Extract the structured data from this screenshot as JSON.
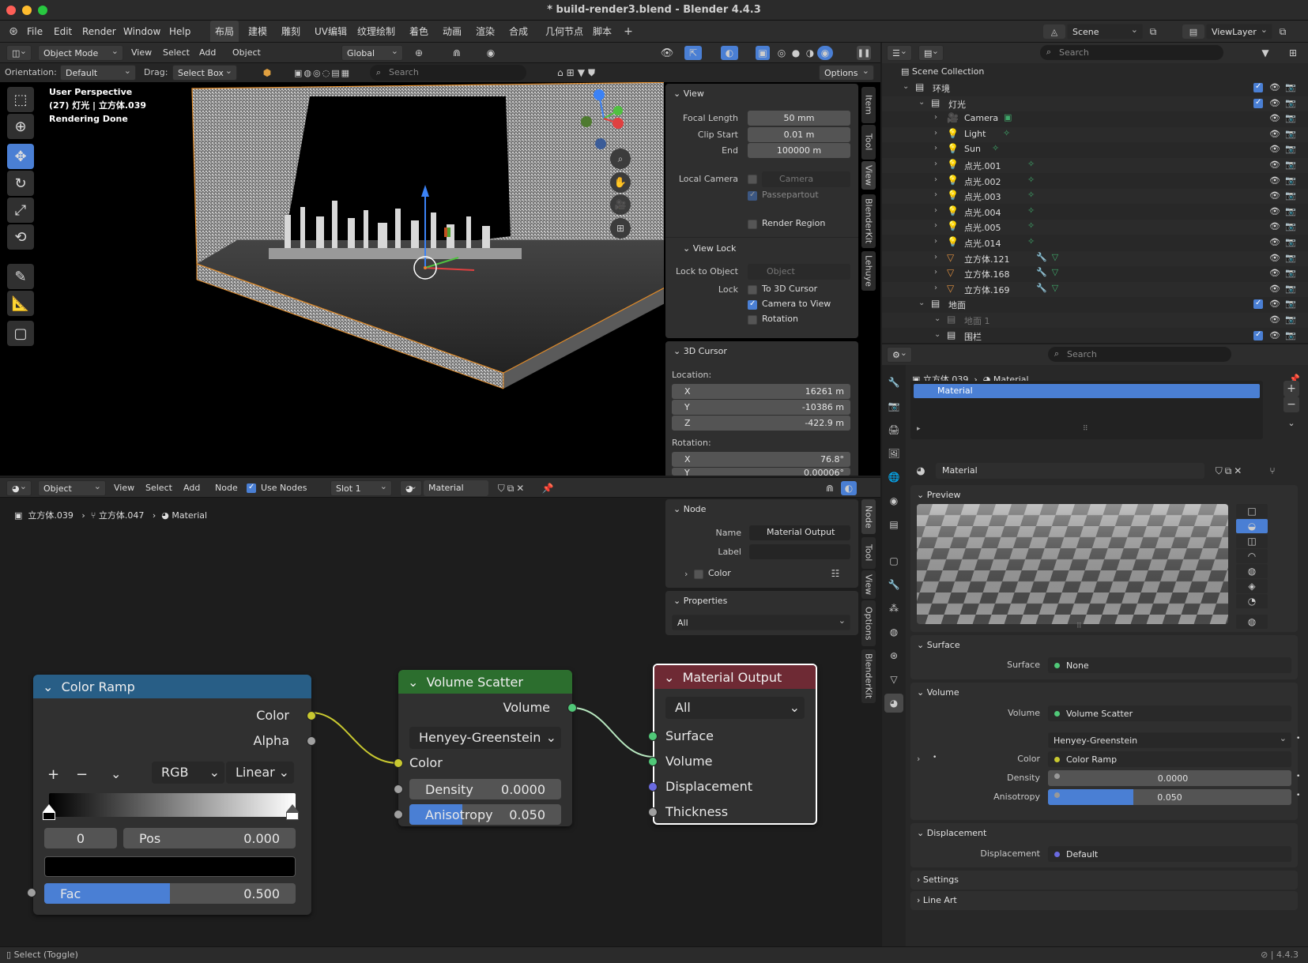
{
  "title": "* build-render3.blend - Blender 4.4.3",
  "menu": [
    "File",
    "Edit",
    "Render",
    "Window",
    "Help"
  ],
  "workspaces": [
    "布局",
    "建模",
    "雕刻",
    "UV编辑",
    "纹理绘制",
    "着色",
    "动画",
    "渲染",
    "合成",
    "几何节点",
    "脚本"
  ],
  "scene": "Scene",
  "viewlayer": "ViewLayer",
  "vp_header": {
    "mode": "Object Mode",
    "items": [
      "View",
      "Select",
      "Add",
      "Object"
    ],
    "transform": "Global"
  },
  "vp_tool": {
    "orientation_label": "Orientation:",
    "orientation": "Default",
    "drag_label": "Drag:",
    "drag": "Select Box",
    "search": "Search",
    "options": "Options"
  },
  "overlay": {
    "line1": "User Perspective",
    "line2": "(27) 灯光 | 立方体.039",
    "line3": "Rendering Done"
  },
  "sidebar_tabs": [
    "Item",
    "Tool",
    "View",
    "BlenderKit",
    "Lehuye"
  ],
  "view_panel": {
    "title": "View",
    "focal_label": "Focal Length",
    "focal": "50 mm",
    "clip_start_label": "Clip Start",
    "clip_start": "0.01 m",
    "end_label": "End",
    "end": "100000 m",
    "local_cam_label": "Local Camera",
    "camera_ph": "Camera",
    "passepartout": "Passepartout",
    "render_region": "Render Region"
  },
  "view_lock": {
    "title": "View Lock",
    "lock_obj_label": "Lock to Object",
    "object_ph": "Object",
    "lock_label": "Lock",
    "to_cursor": "To 3D Cursor",
    "camera_to_view": "Camera to View",
    "rotation": "Rotation"
  },
  "cursor": {
    "title": "3D Cursor",
    "location": "Location:",
    "x": "16261 m",
    "y": "-10386 m",
    "z": "-422.9 m",
    "rotation": "Rotation:",
    "rx": "76.8°",
    "ry": "0.00006°",
    "xl": "X",
    "yl": "Y",
    "zl": "Z"
  },
  "outliner": {
    "search": "Search",
    "root": "Scene Collection",
    "rows": [
      {
        "n": "环境",
        "d": 0,
        "t": "col",
        "cb": true
      },
      {
        "n": "灯光",
        "d": 1,
        "t": "col",
        "cb": true
      },
      {
        "n": "Camera",
        "d": 2,
        "t": "cam"
      },
      {
        "n": "Light",
        "d": 2,
        "t": "light"
      },
      {
        "n": "Sun",
        "d": 2,
        "t": "light"
      },
      {
        "n": "点光.001",
        "d": 2,
        "t": "light"
      },
      {
        "n": "点光.002",
        "d": 2,
        "t": "light"
      },
      {
        "n": "点光.003",
        "d": 2,
        "t": "light"
      },
      {
        "n": "点光.004",
        "d": 2,
        "t": "light"
      },
      {
        "n": "点光.005",
        "d": 2,
        "t": "light"
      },
      {
        "n": "点光.014",
        "d": 2,
        "t": "light"
      },
      {
        "n": "立方体.121",
        "d": 2,
        "t": "mesh"
      },
      {
        "n": "立方体.168",
        "d": 2,
        "t": "mesh"
      },
      {
        "n": "立方体.169",
        "d": 2,
        "t": "mesh"
      },
      {
        "n": "地面",
        "d": 1,
        "t": "col",
        "cb": true
      },
      {
        "n": "地面 1",
        "d": 2,
        "t": "coldis"
      },
      {
        "n": "围栏",
        "d": 2,
        "t": "col",
        "cb": true
      }
    ]
  },
  "props": {
    "search": "Search",
    "crumb1": "立方体.039",
    "crumb2": "Material",
    "slot": "Material",
    "mat_name": "Material",
    "preview": "Preview",
    "surface_sec": "Surface",
    "surface_label": "Surface",
    "surface_val": "None",
    "volume_sec": "Volume",
    "volume_label": "Volume",
    "volume_val": "Volume Scatter",
    "phase": "Henyey-Greenstein",
    "color_label": "Color",
    "color_val": "Color Ramp",
    "density_label": "Density",
    "density": "0.0000",
    "aniso_label": "Anisotropy",
    "aniso": "0.050",
    "aniso_fill": 0.05,
    "disp_sec": "Displacement",
    "disp_label": "Displacement",
    "disp_val": "Default",
    "settings": "Settings",
    "lineart": "Line Art"
  },
  "node_header": {
    "type": "Object",
    "items": [
      "View",
      "Select",
      "Add",
      "Node"
    ],
    "use_nodes": "Use Nodes",
    "slot": "Slot 1",
    "material": "Material"
  },
  "node_crumb": [
    "立方体.039",
    "立方体.047",
    "Material"
  ],
  "node_sidebar": {
    "node_sec": "Node",
    "name_label": "Name",
    "name": "Material Output",
    "label_label": "Label",
    "color": "Color",
    "props_sec": "Properties",
    "all": "All",
    "tabs": [
      "Node",
      "Tool",
      "View",
      "Options",
      "BlenderKit"
    ]
  },
  "color_ramp": {
    "title": "Color Ramp",
    "color": "Color",
    "alpha": "Alpha",
    "mode": "RGB",
    "interp": "Linear",
    "index": "0",
    "pos_label": "Pos",
    "pos": "0.000",
    "fac_label": "Fac",
    "fac": "0.500",
    "fac_fill": 0.5
  },
  "vol_scatter": {
    "title": "Volume Scatter",
    "volume": "Volume",
    "phase": "Henyey-Greenstein",
    "color": "Color",
    "density_label": "Density",
    "density": "0.0000",
    "aniso_label": "Anisotropy",
    "aniso": "0.050",
    "aniso_fill": 0.05
  },
  "mat_output": {
    "title": "Material Output",
    "target": "All",
    "surface": "Surface",
    "volume": "Volume",
    "displacement": "Displacement",
    "thickness": "Thickness"
  },
  "status": {
    "left": "Select (Toggle)",
    "version": "4.4.3"
  }
}
